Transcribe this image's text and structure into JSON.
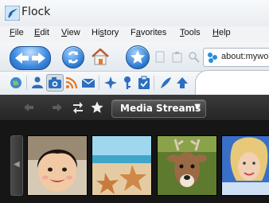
{
  "window": {
    "title": "Flock"
  },
  "menu": {
    "items": [
      {
        "acc": "F",
        "rest": "ile"
      },
      {
        "acc": "E",
        "rest": "dit"
      },
      {
        "acc": "V",
        "rest": "iew"
      },
      {
        "pre": "Hi",
        "acc": "s",
        "rest": "tory"
      },
      {
        "pre": "F",
        "acc": "a",
        "rest": "vorites"
      },
      {
        "acc": "T",
        "rest": "ools"
      },
      {
        "acc": "H",
        "rest": "elp"
      }
    ]
  },
  "urlbar": {
    "value": "about:mywo"
  },
  "media_streams": {
    "selected": "Media Streams",
    "thumbnails": [
      {
        "name": "child-photo"
      },
      {
        "name": "starfish-beach-photo"
      },
      {
        "name": "deer-photo"
      },
      {
        "name": "woman-portrait-photo"
      }
    ]
  },
  "colors": {
    "accent_blue": "#2a78cf",
    "dark_bar": "#262626"
  }
}
